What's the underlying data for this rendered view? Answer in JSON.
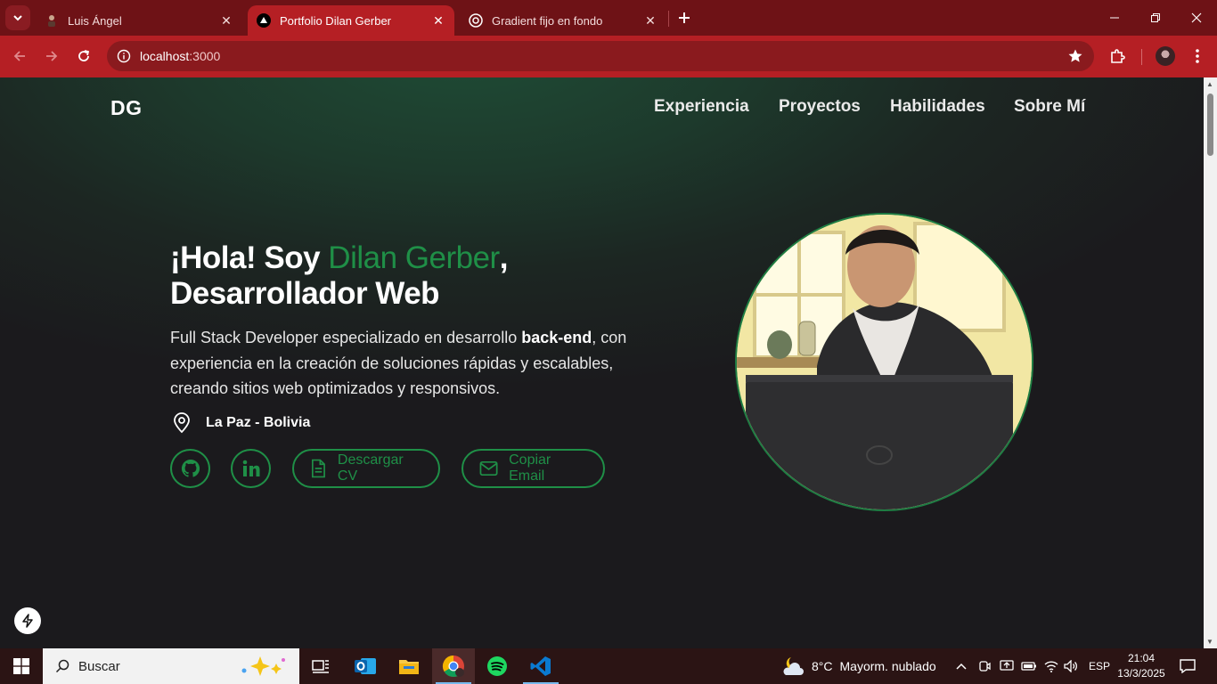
{
  "browser": {
    "tabs": [
      {
        "title": "Luis Ángel",
        "active": false
      },
      {
        "title": "Portfolio Dilan Gerber",
        "active": true
      },
      {
        "title": "Gradient fijo en fondo",
        "active": false
      }
    ],
    "url_host": "localhost",
    "url_port": ":3000"
  },
  "site": {
    "logo": "DG",
    "nav": [
      "Experiencia",
      "Proyectos",
      "Habilidades",
      "Sobre Mí"
    ],
    "hero": {
      "greeting": "¡Hola! Soy ",
      "name": "Dilan Gerber",
      "comma": ",",
      "role": "Desarrollador Web",
      "desc_before": "Full Stack Developer especializado en desarrollo ",
      "desc_bold": "back-end",
      "desc_after": ", con experiencia en la creación de soluciones rápidas y escalables, creando sitios web optimizados y responsivos.",
      "location": "La Paz - Bolivia",
      "cv_button": "Descargar CV",
      "email_button": "Copiar Email"
    }
  },
  "taskbar": {
    "search_placeholder": "Buscar",
    "weather_temp": "8°C",
    "weather_desc": "Mayorm. nublado",
    "lang": "ESP",
    "time": "21:04",
    "date": "13/3/2025"
  },
  "colors": {
    "accent_green": "#1f8f47",
    "browser_red": "#b51f24",
    "tabbar_red": "#6e1216"
  }
}
